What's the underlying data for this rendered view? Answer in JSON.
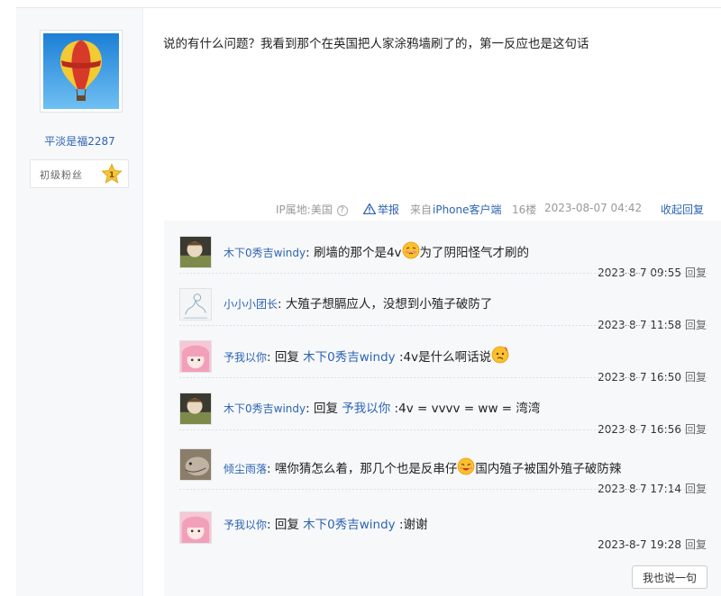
{
  "author": {
    "name": "平淡是福2287",
    "fan_level_label": "初级粉丝",
    "fan_level": "1"
  },
  "post": {
    "text": "说的有什么问题？我看到那个在英国把人家涂鸦墙刷了的，第一反应也是这句话"
  },
  "meta": {
    "ip_label": "IP属地:美国",
    "ip_help": "?",
    "report": "举报",
    "source_prefix": "来自",
    "source_link": "iPhone客户端",
    "floor": "16楼",
    "datetime": "2023-08-07 04:42",
    "collapse": "收起回复"
  },
  "replies": [
    {
      "user": "木下0秀吉windy",
      "sep": ":",
      "before": " 刷墙的那个是4v",
      "emoji": "shy-face-emoji",
      "after": "为了阴阳怪气才刷的",
      "time": "2023-8-7 09:55",
      "reply_label": "回复"
    },
    {
      "user": "小小小团长",
      "sep": ":",
      "before": " 大殖子想膈应人，没想到小殖子破防了",
      "time": "2023-8-7 11:58",
      "reply_label": "回复"
    },
    {
      "user": "予我以你",
      "sep": ":",
      "prefix": " 回复 ",
      "target": "木下0秀吉windy",
      "before": " :4v是什么啊话说",
      "emoji": "confused-face-emoji",
      "time": "2023-8-7 16:50",
      "reply_label": "回复"
    },
    {
      "user": "木下0秀吉windy",
      "sep": ":",
      "prefix": " 回复 ",
      "target": "予我以你",
      "before": " :4v = vvvv = ww = 湾湾",
      "time": "2023-8-7 16:56",
      "reply_label": "回复"
    },
    {
      "user": "倾尘雨落",
      "sep": ":",
      "before": " 嘿你猜怎么着，那几个也是反串仔",
      "emoji": "smirk-face-emoji",
      "after": "国内殖子被国外殖子破防辣",
      "time": "2023-8-7 17:14",
      "reply_label": "回复"
    },
    {
      "user": "予我以你",
      "sep": ":",
      "prefix": " 回复 ",
      "target": "木下0秀吉windy",
      "before": " :谢谢",
      "time": "2023-8-7 19:28",
      "reply_label": "回复"
    }
  ],
  "say_button": "我也说一句",
  "colors": {
    "link": "#2d64b3",
    "panel": "#f7f8fa",
    "balloon_red": "#d83a2a",
    "balloon_yellow": "#f3c934",
    "sky": "#2f8fe0"
  }
}
